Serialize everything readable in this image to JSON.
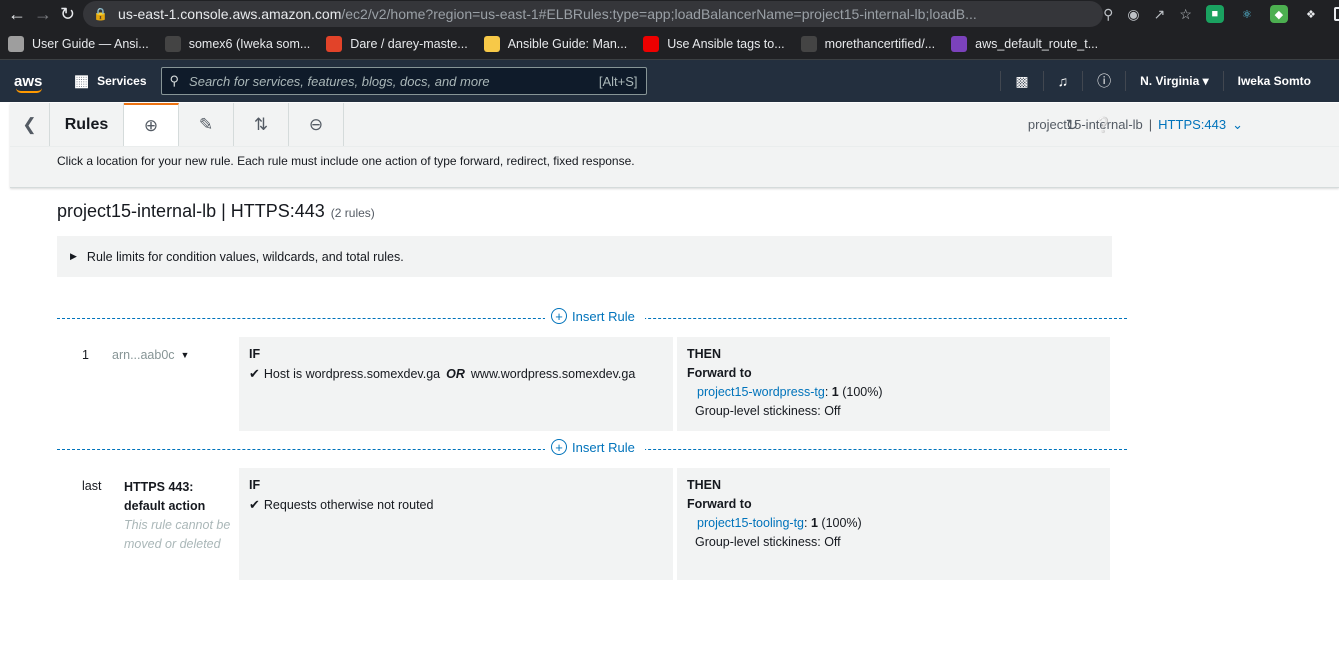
{
  "browser": {
    "url_host": "us-east-1.console.aws.amazon.com",
    "url_rest": "/ec2/v2/home?region=us-east-1#ELBRules:type=app;loadBalancerName=project15-internal-lb;loadB...",
    "bookmarks": [
      {
        "label": "User Guide — Ansi...",
        "color": "#9e9e9e"
      },
      {
        "label": "somex6 (Iweka som...",
        "color": "#444444"
      },
      {
        "label": "Dare / darey-maste...",
        "color": "#e24329"
      },
      {
        "label": "Ansible Guide: Man...",
        "color": "#f7c948"
      },
      {
        "label": "Use Ansible tags to...",
        "color": "#ee0000"
      },
      {
        "label": "morethancertified/...",
        "color": "#444444"
      },
      {
        "label": "aws_default_route_t...",
        "color": "#7b42bc"
      }
    ]
  },
  "aws": {
    "logo": "aws",
    "services": "Services",
    "search_placeholder": "Search for services, features, blogs, docs, and more",
    "search_shortcut": "[Alt+S]",
    "region": "N. Virginia",
    "user": "Iweka Somto"
  },
  "toolbar": {
    "title": "Rules",
    "lb_name": "project15-internal-lb",
    "sep": "|",
    "listener": "HTTPS:443",
    "hint": "Click a location for your new rule. Each rule must include one action of type forward, redirect, fixed response."
  },
  "page": {
    "title": "project15-internal-lb | HTTPS:443",
    "count": "(2 rules)",
    "limits": "Rule limits for condition values, wildcards, and total rules.",
    "insert_label": "Insert Rule"
  },
  "rules": [
    {
      "num": "1",
      "arn": "arn...aab0c",
      "if_label": "IF",
      "cond_a": "Host is wordpress.somexdev.ga",
      "cond_or": "OR",
      "cond_b": "www.wordpress.somexdev.ga",
      "then_label": "THEN",
      "action": "Forward to",
      "tg": "project15-wordpress-tg",
      "weight": "1",
      "pct": "(100%)",
      "stickiness": "Group-level stickiness: Off"
    },
    {
      "num": "last",
      "name": "HTTPS 443:",
      "name2": "default action",
      "note": "This rule cannot be moved or deleted",
      "if_label": "IF",
      "cond_a": "Requests otherwise not routed",
      "then_label": "THEN",
      "action": "Forward to",
      "tg": "project15-tooling-tg",
      "weight": "1",
      "pct": "(100%)",
      "stickiness": "Group-level stickiness: Off"
    }
  ]
}
